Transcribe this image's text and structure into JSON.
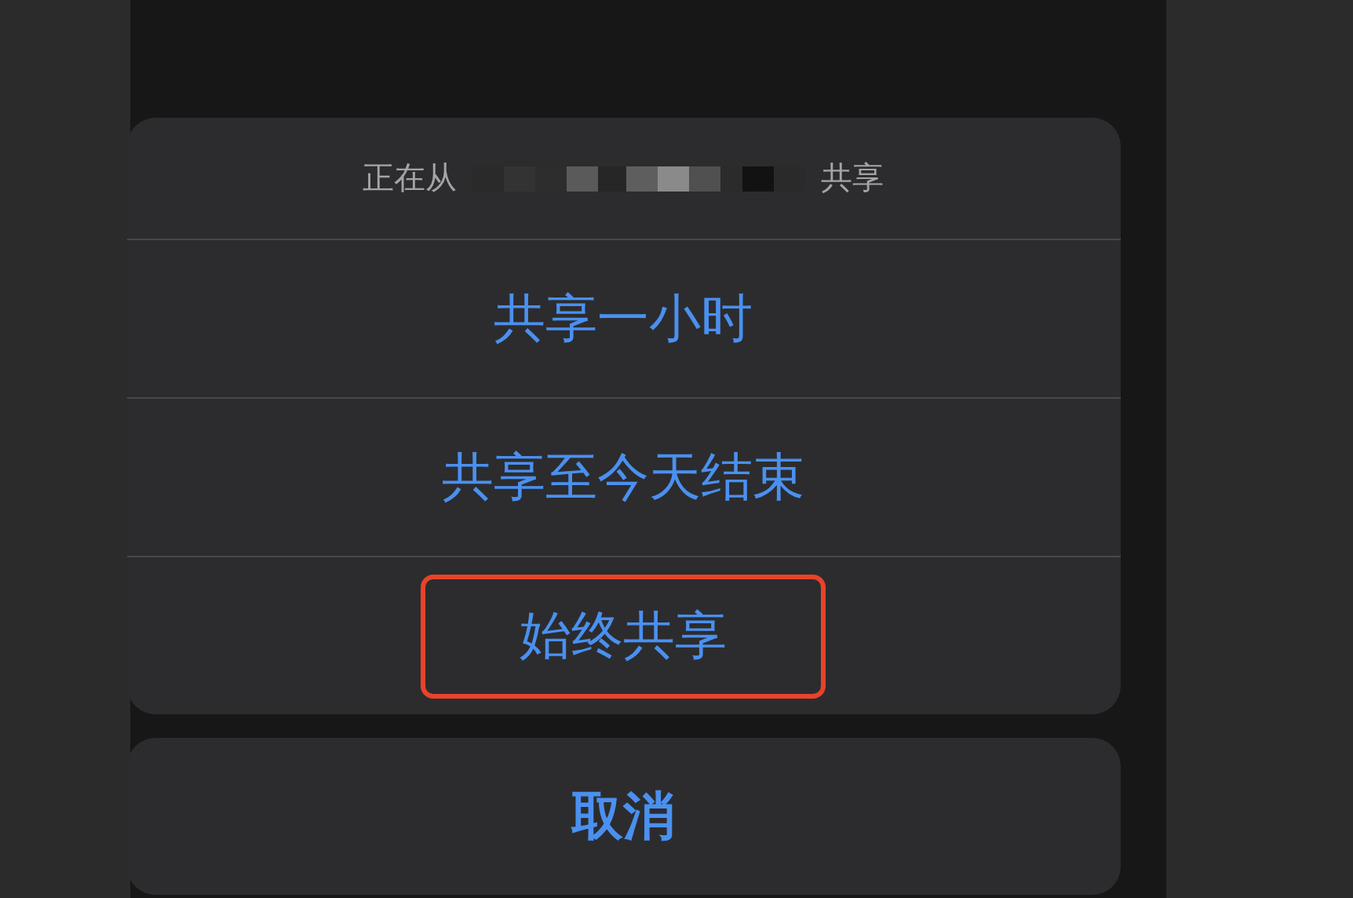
{
  "sheet": {
    "header_before": "正在从",
    "header_after": "共享",
    "header_redacted": true,
    "options": [
      {
        "label": "共享一小时",
        "highlighted": false
      },
      {
        "label": "共享至今天结束",
        "highlighted": false
      },
      {
        "label": "始终共享",
        "highlighted": true
      }
    ]
  },
  "cancel": {
    "label": "取消"
  }
}
